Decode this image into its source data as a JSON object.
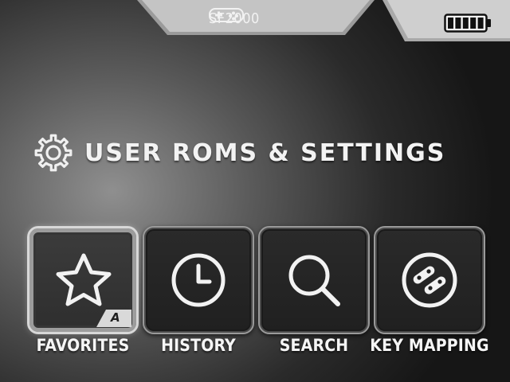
{
  "status_bar": {
    "console_name": "SF2000",
    "console_icon": "gamepad-icon",
    "battery_icon": "battery-full-icon",
    "battery_level": 1.0
  },
  "heading": {
    "icon": "gear-icon",
    "text": "USER ROMS & SETTINGS"
  },
  "menu": {
    "selected_index": 0,
    "items": [
      {
        "label": "FAVORITES",
        "icon": "star-icon",
        "badge": "A"
      },
      {
        "label": "HISTORY",
        "icon": "clock-icon"
      },
      {
        "label": "SEARCH",
        "icon": "magnifier-icon"
      },
      {
        "label": "KEY MAPPING",
        "icon": "key-mapping-icon"
      }
    ]
  },
  "colors": {
    "text": "#f4f4f4",
    "tile_border": "#9a9a9a",
    "tile_selected_border": "#d8d8d8"
  }
}
